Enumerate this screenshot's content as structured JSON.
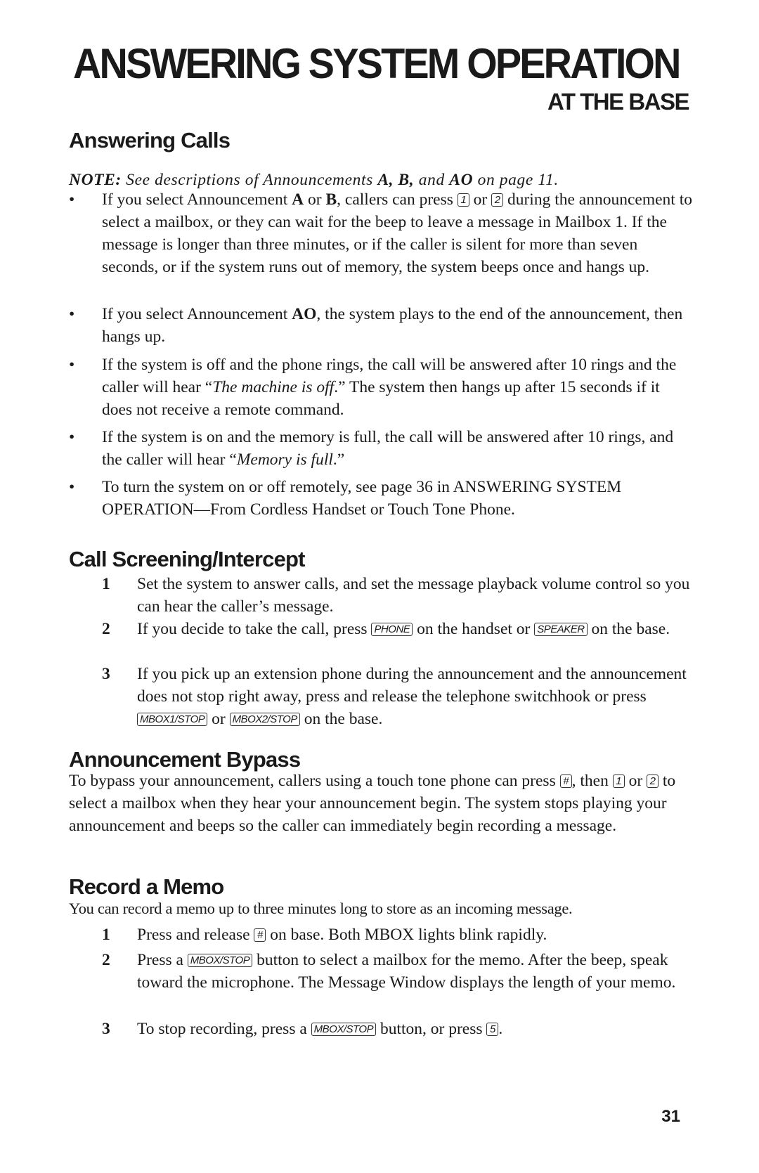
{
  "header": {
    "title": "ANSWERING SYSTEM OPERATION",
    "subtitle": "AT THE BASE"
  },
  "sections": {
    "answering_calls": {
      "heading": "Answering Calls",
      "note": {
        "prefix": "NOTE:",
        "text1": " See descriptions of Announcements ",
        "bold1": "A, B,",
        "text2": " and ",
        "bold2": "AO",
        "text3": " on page 11."
      },
      "bullets": [
        {
          "t1": "If you select Announcement ",
          "b1": "A",
          "t2": " or ",
          "b2": "B",
          "t3": ", callers can press ",
          "key1": "1",
          "t4": " or ",
          "key2": "2",
          "t5": " during the announcement to select a mailbox, or they can wait for the beep to leave a message in Mailbox 1.  If the message is longer than three minutes, or if the caller is silent for more than seven seconds, or if the system runs out of memory, the system beeps once and hangs up."
        },
        {
          "t1": "If you select Announcement ",
          "b1": "AO",
          "t2": ", the system plays to the end of the announcement, then hangs up."
        },
        {
          "t1": "If the system is off and the phone rings, the call will be answered after 10 rings and the caller will hear “",
          "i1": "The machine is off",
          "t2": ".”  The system then hangs up after 15 seconds if it does not receive a remote command."
        },
        {
          "t1": "If the system is on and the memory is full, the call will be answered after 10 rings, and the caller will hear “",
          "i1": "Memory is full",
          "t2": ".”"
        },
        {
          "t1": "To turn the system on or off remotely, see page 36 in ANSWERING SYSTEM OPERATION—From Cordless Handset or Touch Tone Phone."
        }
      ],
      "bullet_glyph": "•"
    },
    "call_screening": {
      "heading": "Call Screening/Intercept",
      "steps": [
        {
          "num": "1",
          "t1": "Set the system to answer calls, and set the message playback volume control so you can hear the caller’s message."
        },
        {
          "num": "2",
          "t1": "If you decide to take the call, press ",
          "key1": "PHONE",
          "t2": " on the handset or ",
          "key2": "SPEAKER",
          "t3": " on the base."
        },
        {
          "num": "3",
          "t1": "If you pick up an extension phone during the announcement and the announcement does not stop right away, press and release the telephone switchhook or press ",
          "key1": "MBOX1/STOP",
          "t2": " or ",
          "key2": "MBOX2/STOP",
          "t3": " on the base."
        }
      ]
    },
    "announcement_bypass": {
      "heading": "Announcement  Bypass",
      "t1": "To bypass your announcement, callers using a touch tone phone can press ",
      "key1": "#",
      "t2": ", then ",
      "key2": "1",
      "t3": " or ",
      "key3": "2",
      "t4": " to select a mailbox when they hear your announcement begin. The system stops playing your announcement and beeps so the caller can immediately begin recording a message."
    },
    "record_memo": {
      "heading": "Record a Memo",
      "intro": "You can record a memo up to three minutes long to store as an incoming message.",
      "steps": [
        {
          "num": "1",
          "t1": "Press and release ",
          "key1": "#",
          "t2": " on base.  Both MBOX lights blink rapidly."
        },
        {
          "num": "2",
          "t1": "Press a ",
          "key1": "MBOX/STOP",
          "t2": " button to select a mailbox for the memo. After the beep, speak toward the microphone. The Message Window displays the length of your memo."
        },
        {
          "num": "3",
          "t1": "To stop recording, press a ",
          "key1": "MBOX/STOP",
          "t2": " button, or press ",
          "key2": "5",
          "t3": "."
        }
      ]
    }
  },
  "footer": {
    "page_number": "31"
  }
}
